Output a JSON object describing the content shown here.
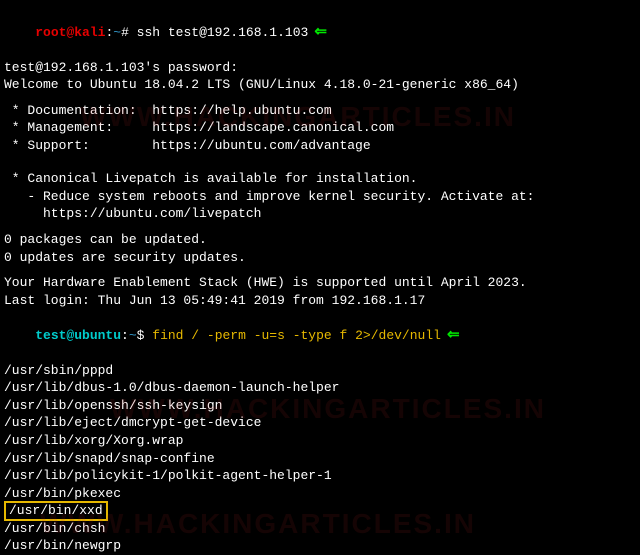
{
  "prompt1": {
    "user": "root@kali",
    "sep1": ":",
    "path": "~",
    "sep2": "# ",
    "cmd": "ssh test@192.168.1.103"
  },
  "ssh": {
    "pw": "test@192.168.1.103's password:",
    "welcome": "Welcome to Ubuntu 18.04.2 LTS (GNU/Linux 4.18.0-21-generic x86_64)",
    "doc": " * Documentation:  https://help.ubuntu.com",
    "mgmt": " * Management:     https://landscape.canonical.com",
    "supp": " * Support:        https://ubuntu.com/advantage",
    "live1": " * Canonical Livepatch is available for installation.",
    "live2": "   - Reduce system reboots and improve kernel security. Activate at:",
    "live3": "     https://ubuntu.com/livepatch",
    "pkg1": "0 packages can be updated.",
    "pkg2": "0 updates are security updates.",
    "hwe": "Your Hardware Enablement Stack (HWE) is supported until April 2023.",
    "last": "Last login: Thu Jun 13 05:49:41 2019 from 192.168.1.17"
  },
  "prompt2": {
    "user": "test@ubuntu",
    "sep1": ":",
    "path": "~",
    "sep2": "$ ",
    "cmd": "find / -perm -u=s -type f 2>/dev/null"
  },
  "out": [
    "/usr/sbin/pppd",
    "/usr/lib/dbus-1.0/dbus-daemon-launch-helper",
    "/usr/lib/openssh/ssh-keysign",
    "/usr/lib/eject/dmcrypt-get-device",
    "/usr/lib/xorg/Xorg.wrap",
    "/usr/lib/snapd/snap-confine",
    "/usr/lib/policykit-1/polkit-agent-helper-1",
    "/usr/bin/pkexec"
  ],
  "boxed": "/usr/bin/xxd",
  "out_after": [
    "/usr/bin/chsh",
    "/usr/bin/newgrp"
  ],
  "watermark": "WWW.HACKINGARTICLES.IN"
}
